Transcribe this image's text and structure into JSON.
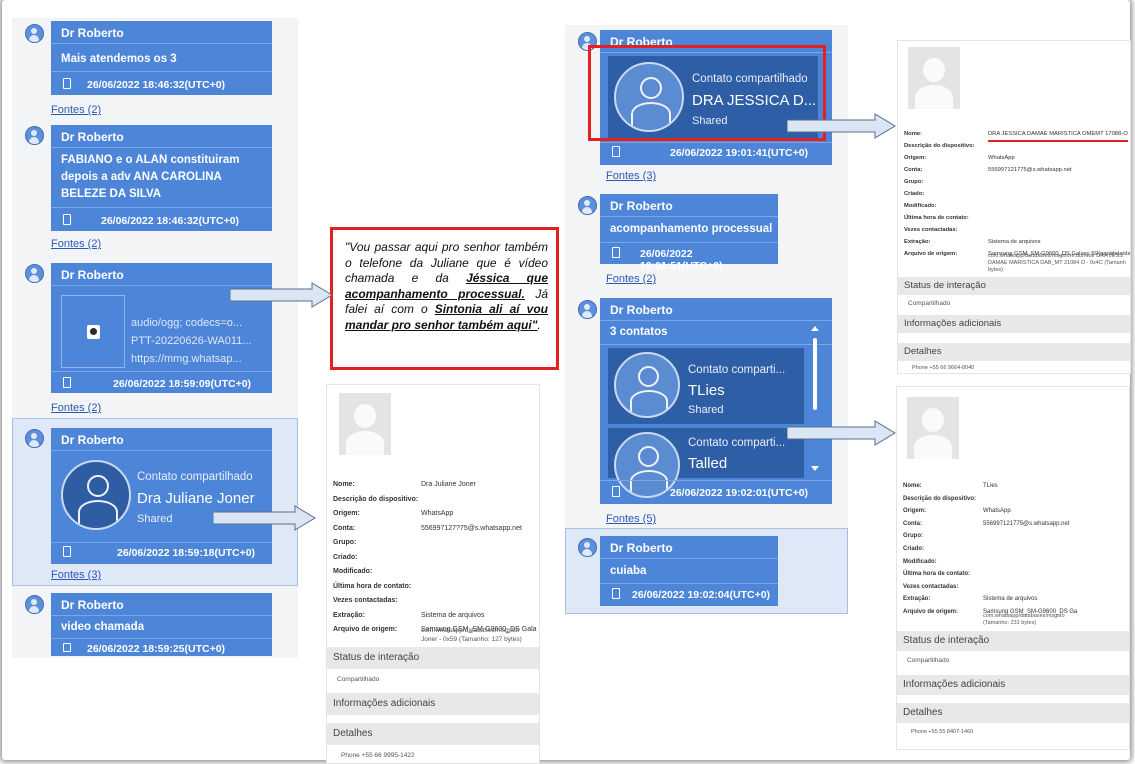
{
  "left_chat": {
    "sender": "Dr Roberto",
    "messages": [
      {
        "text": "Mais atendemos os 3",
        "timestamp": "26/06/2022 18:46:32(UTC+0)",
        "fontes": "Fontes (2)"
      },
      {
        "text_lines": [
          "FABIANO e o ALAN constituiram",
          "depois a adv ANA CAROLINA",
          "BELEZE DA SILVA"
        ],
        "timestamp": "26/06/2022 18:46:32(UTC+0)",
        "fontes": "Fontes (2)"
      },
      {
        "audio_lines": [
          "audio/ogg; codecs=o...",
          "PTT-20220626-WA011...",
          "https://mmg.whatsap..."
        ],
        "timestamp": "26/06/2022 18:59:09(UTC+0)",
        "fontes": "Fontes (2)"
      },
      {
        "contact_title": "Contato compartilhado",
        "contact_name": "Dra Juliane Joner",
        "contact_status": "Shared",
        "timestamp": "26/06/2022 18:59:18(UTC+0)",
        "fontes": "Fontes (3)"
      },
      {
        "text": "video chamada",
        "timestamp": "26/06/2022 18:59:25(UTC+0)"
      }
    ]
  },
  "quote": {
    "part1": "\"Vou passar aqui pro senhor também o telefone da Juliane que é vídeo chamada e da ",
    "bold1": "Jéssica que acompanhamento processual.",
    "part2": " Já falei aí com o ",
    "bold2": "Sintonia ali aí vou mandar pro senhor também aqui\"",
    "part3": "."
  },
  "detail_juliane": {
    "fields": [
      {
        "k": "Nome:",
        "v": "Dra Juliane Joner"
      },
      {
        "k": "Descrição do dispositivo:",
        "v": ""
      },
      {
        "k": "Origem:",
        "v": "WhatsApp"
      },
      {
        "k": "Conta:",
        "v": "556997127?75@s.whatsapp.net"
      },
      {
        "k": "Grupo:",
        "v": ""
      },
      {
        "k": "Criado:",
        "v": ""
      },
      {
        "k": "Modificado:",
        "v": ""
      },
      {
        "k": "Última hora de contato:",
        "v": ""
      },
      {
        "k": "Vezes contactadas:",
        "v": ""
      },
      {
        "k": "Extração:",
        "v": "Sistema de arquivos"
      },
      {
        "k": "Arquivo de origem:",
        "v": "Samsung GSM_SM-G9600_DS Gala"
      }
    ],
    "origem_extra": [
      "com.whatsapp/databases/msgstor",
      "Joner - 0x59 (Tamanho: 127 bytes)"
    ],
    "status_title": "Status de interação",
    "status_value": "Compartilhado",
    "info_title": "Informações adicionais",
    "details_title": "Detalhes",
    "phone": "Phone  +55 66 9995-1422"
  },
  "right_chat": {
    "sender": "Dr Roberto",
    "messages": [
      {
        "contact_title": "Contato compartilhado",
        "contact_name": "DRA JESSICA D...",
        "contact_status": "Shared",
        "timestamp": "26/06/2022 19:01:41(UTC+0)",
        "fontes": "Fontes (3)"
      },
      {
        "text": "acompanhamento processual",
        "timestamp": "26/06/2022 19:01:51(UTC+0)",
        "fontes": "Fontes (2)"
      },
      {
        "header": "3 contatos",
        "contacts": [
          {
            "title": "Contato comparti...",
            "name": "TLies",
            "status": "Shared"
          },
          {
            "title": "Contato comparti...",
            "name": "Talled",
            "status": ""
          }
        ],
        "timestamp": "26/06/2022 19:02:01(UTC+0)",
        "fontes": "Fontes (5)"
      },
      {
        "text": "cuiaba",
        "timestamp": "26/06/2022 19:02:04(UTC+0)"
      }
    ]
  },
  "detail_jessica": {
    "fields": [
      {
        "k": "Nome:",
        "v": "DRA JESSICA DAMAE MARISTICA OMEMT 17088-O"
      },
      {
        "k": "Descrição do dispositivo:",
        "v": ""
      },
      {
        "k": "Origem:",
        "v": "WhatsApp"
      },
      {
        "k": "Conta:",
        "v": "556997121775@s.whatsapp.net"
      },
      {
        "k": "Grupo:",
        "v": ""
      },
      {
        "k": "Criado:",
        "v": ""
      },
      {
        "k": "Modificado:",
        "v": ""
      },
      {
        "k": "Última hora de contato:",
        "v": ""
      },
      {
        "k": "Vezes contactadas:",
        "v": ""
      },
      {
        "k": "Extração:",
        "v": "Sistema de arquivos"
      },
      {
        "k": "Arquivo de origem:",
        "v": "Samsung GSM_SM-G9600_DS Galaxy S9(qaq/data/data/"
      }
    ],
    "origem_extra": [
      "com.whatsapp/databases/msgstore.db/root/ DRA JESS",
      "DAMAE MARISTICA DAB_MT 21084 O - 0x4C (Tamanh",
      "bytes)"
    ],
    "status_title": "Status de interação",
    "status_value": "Compartilhado",
    "info_title": "Informações adicionais",
    "details_title": "Detalhes",
    "phone": "Phone  +55 66 9664-8040"
  },
  "detail_tlies": {
    "fields": [
      {
        "k": "Nome:",
        "v": "TLies"
      },
      {
        "k": "Descrição do dispositivo:",
        "v": ""
      },
      {
        "k": "Origem:",
        "v": "WhatsApp"
      },
      {
        "k": "Conta:",
        "v": "556997121775@s.whatsapp.net"
      },
      {
        "k": "Grupo:",
        "v": ""
      },
      {
        "k": "Criado:",
        "v": ""
      },
      {
        "k": "Modificado:",
        "v": ""
      },
      {
        "k": "Última hora de contato:",
        "v": ""
      },
      {
        "k": "Vezes contactadas:",
        "v": ""
      },
      {
        "k": "Extração:",
        "v": "Sistema de arquivos"
      },
      {
        "k": "Arquivo de origem:",
        "v": "Samsung GSM_SM-G9600_DS Ga"
      }
    ],
    "origem_extra": [
      "com.whatsapp/databases/msgsto",
      "(Tamanho: 231 bytes)"
    ],
    "status_title": "Status de interação",
    "status_value": "Compartilhado",
    "info_title": "Informações adicionais",
    "details_title": "Detalhes",
    "phone": "Phone  +55 55 8407-1460"
  },
  "colors": {
    "bubble": "#4d86d9",
    "card": "#2e5ea5",
    "highlight": "#e32121",
    "link": "#2c58b8"
  },
  "icons": [
    "contact-avatar-icon",
    "phone-icon",
    "play-icon",
    "arrow-icon"
  ]
}
